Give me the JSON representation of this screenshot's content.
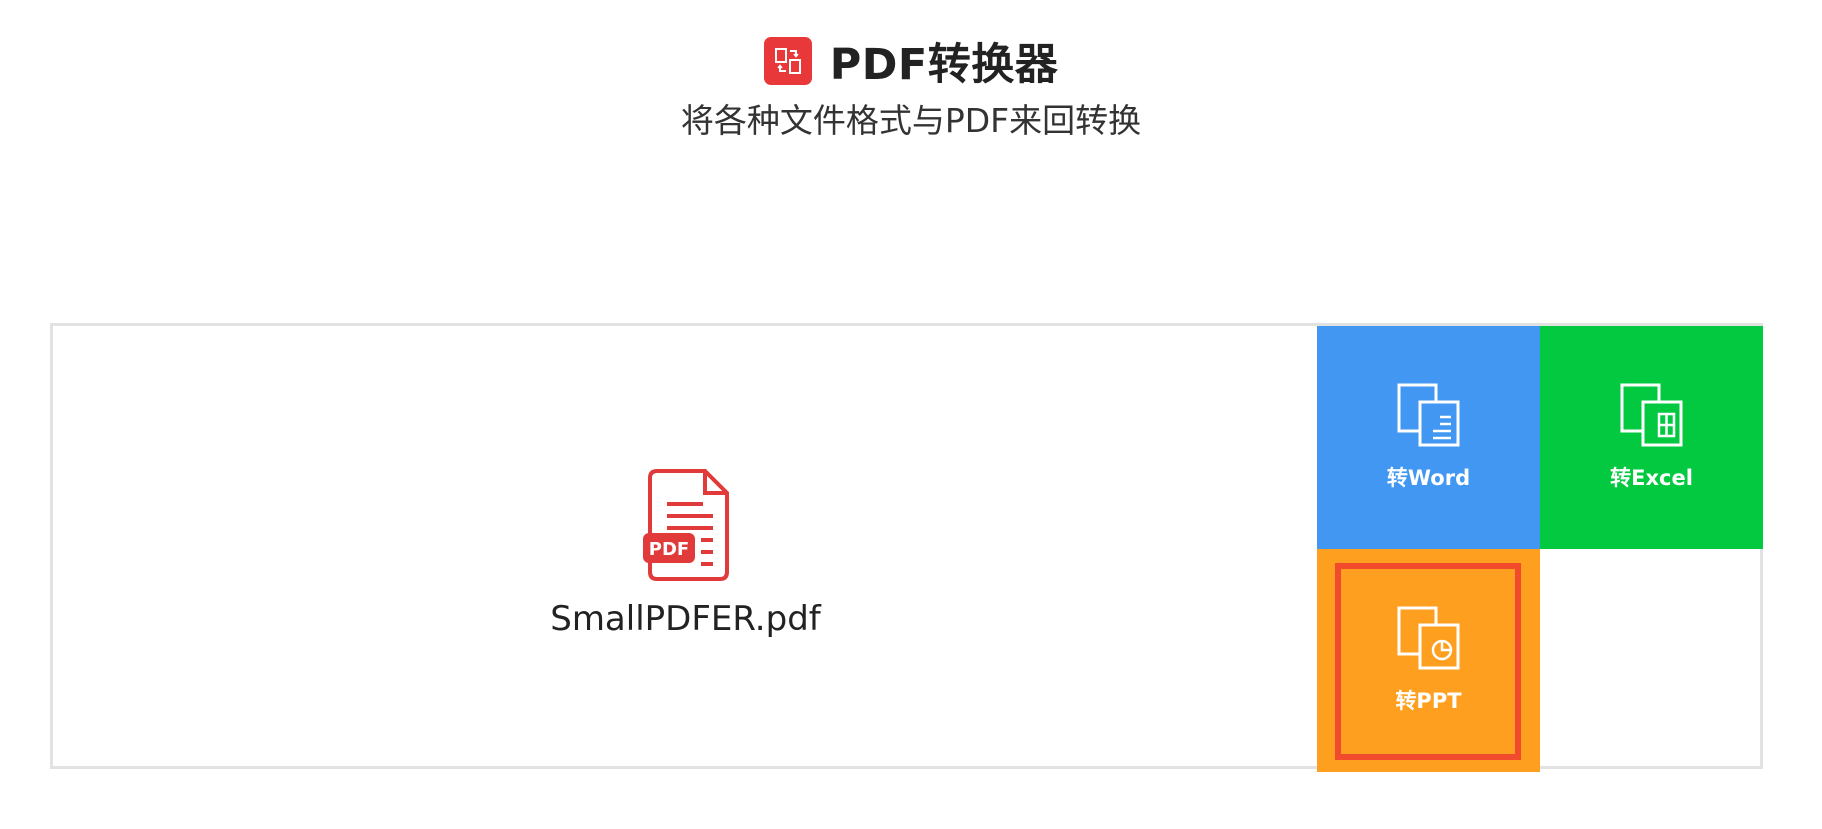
{
  "header": {
    "title": "PDF转换器",
    "subtitle": "将各种文件格式与PDF来回转换",
    "logo_icon": "swap-documents-icon",
    "logo_color": "#e8383a"
  },
  "file": {
    "name": "SmallPDFER.pdf",
    "badge": "PDF",
    "icon": "pdf-file-icon",
    "icon_color": "#e13a3a"
  },
  "actions": {
    "word": {
      "label": "转Word",
      "icon": "word-document-icon",
      "color": "#4197f2"
    },
    "excel": {
      "label": "转Excel",
      "icon": "excel-document-icon",
      "color": "#03c940"
    },
    "ppt": {
      "label": "转PPT",
      "icon": "ppt-document-icon",
      "color": "#fe9f1f",
      "highlight_color": "#f24a2d"
    }
  }
}
